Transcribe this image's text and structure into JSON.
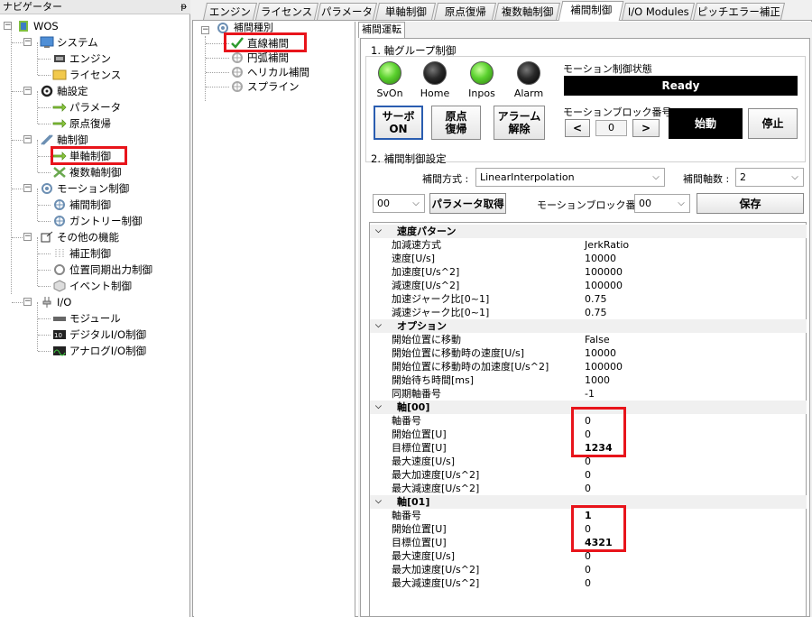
{
  "navigator": {
    "title": "ナビゲーター",
    "pin": "ᵽ",
    "items": [
      {
        "label": "WOS"
      },
      {
        "label": "システム"
      },
      {
        "label": "エンジン"
      },
      {
        "label": "ライセンス"
      },
      {
        "label": "軸設定"
      },
      {
        "label": "パラメータ"
      },
      {
        "label": "原点復帰"
      },
      {
        "label": "軸制御"
      },
      {
        "label": "単軸制御"
      },
      {
        "label": "複数軸制御"
      },
      {
        "label": "モーション制御"
      },
      {
        "label": "補間制御"
      },
      {
        "label": "ガントリー制御"
      },
      {
        "label": "その他の機能"
      },
      {
        "label": "補正制御"
      },
      {
        "label": "位置同期出力制御"
      },
      {
        "label": "イベント制御"
      },
      {
        "label": "I/O"
      },
      {
        "label": "モジュール"
      },
      {
        "label": "デジタルI/O制御"
      },
      {
        "label": "アナログI/O制御"
      }
    ]
  },
  "tabs": [
    "エンジン",
    "ライセンス",
    "パラメータ",
    "単軸制御",
    "原点復帰",
    "複数軸制御",
    "補間制御",
    "I/O Modules",
    "ピッチエラー補正"
  ],
  "active_tab": "補間制御",
  "interp_tree": {
    "root": "補間種別",
    "items": [
      "直線補間",
      "円弧補間",
      "ヘリカル補間",
      "スプライン"
    ]
  },
  "run_tab": "補間運転",
  "group1": {
    "title": "1. 軸グループ制御",
    "lamps": [
      {
        "label": "SvOn",
        "color": "#5ad12e"
      },
      {
        "label": "Home",
        "color": "#2a2a2a"
      },
      {
        "label": "Inpos",
        "color": "#5ad12e"
      },
      {
        "label": "Alarm",
        "color": "#2a2a2a"
      }
    ],
    "motion_state_label": "モーション制御状態",
    "motion_state_value": "Ready",
    "buttons": {
      "servo": "サーボ\nON",
      "home": "原点\n復帰",
      "alarm": "アラーム\n解除",
      "start": "始動",
      "stop": "停止"
    },
    "block_label": "モーションブロック番号",
    "block_value": "0",
    "prev": "<",
    "next": ">"
  },
  "group2": {
    "title": "2. 補間制御設定",
    "method_label": "補間方式 :",
    "method_value": "LinearInterpolation",
    "axes_label": "補間軸数 :",
    "axes_value": "2",
    "group_value": "00",
    "get_params": "パラメータ取得",
    "block_label": "モーションブロック番号:",
    "block_value": "00",
    "save": "保存"
  },
  "properties": [
    {
      "type": "cat",
      "k": "速度パターン"
    },
    {
      "k": "加減速方式",
      "v": "JerkRatio"
    },
    {
      "k": "速度[U/s]",
      "v": "10000"
    },
    {
      "k": "加速度[U/s^2]",
      "v": "100000"
    },
    {
      "k": "減速度[U/s^2]",
      "v": "100000"
    },
    {
      "k": "加速ジャーク比[0~1]",
      "v": "0.75"
    },
    {
      "k": "減速ジャーク比[0~1]",
      "v": "0.75"
    },
    {
      "type": "cat",
      "k": "オプション"
    },
    {
      "k": "開始位置に移動",
      "v": "False"
    },
    {
      "k": "開始位置に移動時の速度[U/s]",
      "v": "10000"
    },
    {
      "k": "開始位置に移動時の加速度[U/s^2]",
      "v": "100000"
    },
    {
      "k": "開始待ち時間[ms]",
      "v": "1000"
    },
    {
      "k": "同期軸番号",
      "v": "-1"
    },
    {
      "type": "cat",
      "k": "軸[00]"
    },
    {
      "k": "軸番号",
      "v": "0"
    },
    {
      "k": "開始位置[U]",
      "v": "0"
    },
    {
      "k": "目標位置[U]",
      "v": "1234",
      "bold": true
    },
    {
      "k": "最大速度[U/s]",
      "v": "0"
    },
    {
      "k": "最大加速度[U/s^2]",
      "v": "0"
    },
    {
      "k": "最大減速度[U/s^2]",
      "v": "0"
    },
    {
      "type": "cat",
      "k": "軸[01]"
    },
    {
      "k": "軸番号",
      "v": "1",
      "bold": true
    },
    {
      "k": "開始位置[U]",
      "v": "0"
    },
    {
      "k": "目標位置[U]",
      "v": "4321",
      "bold": true
    },
    {
      "k": "最大速度[U/s]",
      "v": "0"
    },
    {
      "k": "最大加速度[U/s^2]",
      "v": "0"
    },
    {
      "k": "最大減速度[U/s^2]",
      "v": "0"
    }
  ]
}
